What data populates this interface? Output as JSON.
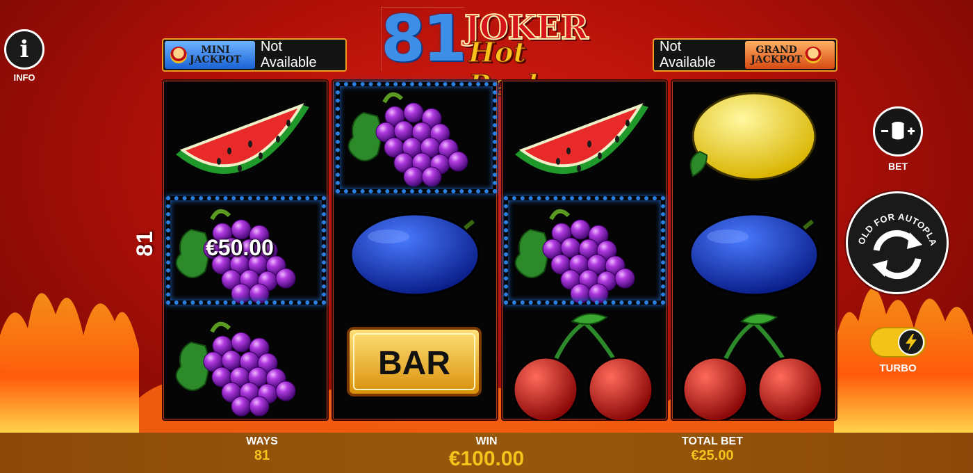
{
  "info": {
    "label": "INFO",
    "icon": "info-icon"
  },
  "logo": {
    "number": "81",
    "title": "JOKER",
    "subtitle": "Hot Reels"
  },
  "jackpots": {
    "mini": {
      "line1": "MINI",
      "line2": "JACKPOT",
      "value": "Not Available"
    },
    "grand": {
      "line1": "GRAND",
      "line2": "JACKPOT",
      "value": "Not Available"
    }
  },
  "ways_banner": "81 WAYS",
  "reels": [
    [
      "watermelon",
      "grapes",
      "grapes"
    ],
    [
      "grapes",
      "plum",
      "bar"
    ],
    [
      "watermelon",
      "grapes",
      "cherries"
    ],
    [
      "lemon",
      "plum",
      "cherries"
    ]
  ],
  "symbols": {
    "bar_text": "BAR"
  },
  "win_highlight": {
    "amount": "€50.00"
  },
  "controls": {
    "bet_label": "BET",
    "autoplay_text": "HOLD FOR AUTOPLAY",
    "turbo_label": "TURBO",
    "turbo_on": true
  },
  "bottom_bar": {
    "ways_label": "WAYS",
    "ways_value": "81",
    "win_label": "WIN",
    "win_value": "€100.00",
    "bet_label": "TOTAL BET",
    "bet_value": "€25.00"
  },
  "colors": {
    "background": "#c8170e",
    "win_frame": "#2a7fe0",
    "gold": "#f6c21c",
    "turbo": "#f2c418"
  }
}
